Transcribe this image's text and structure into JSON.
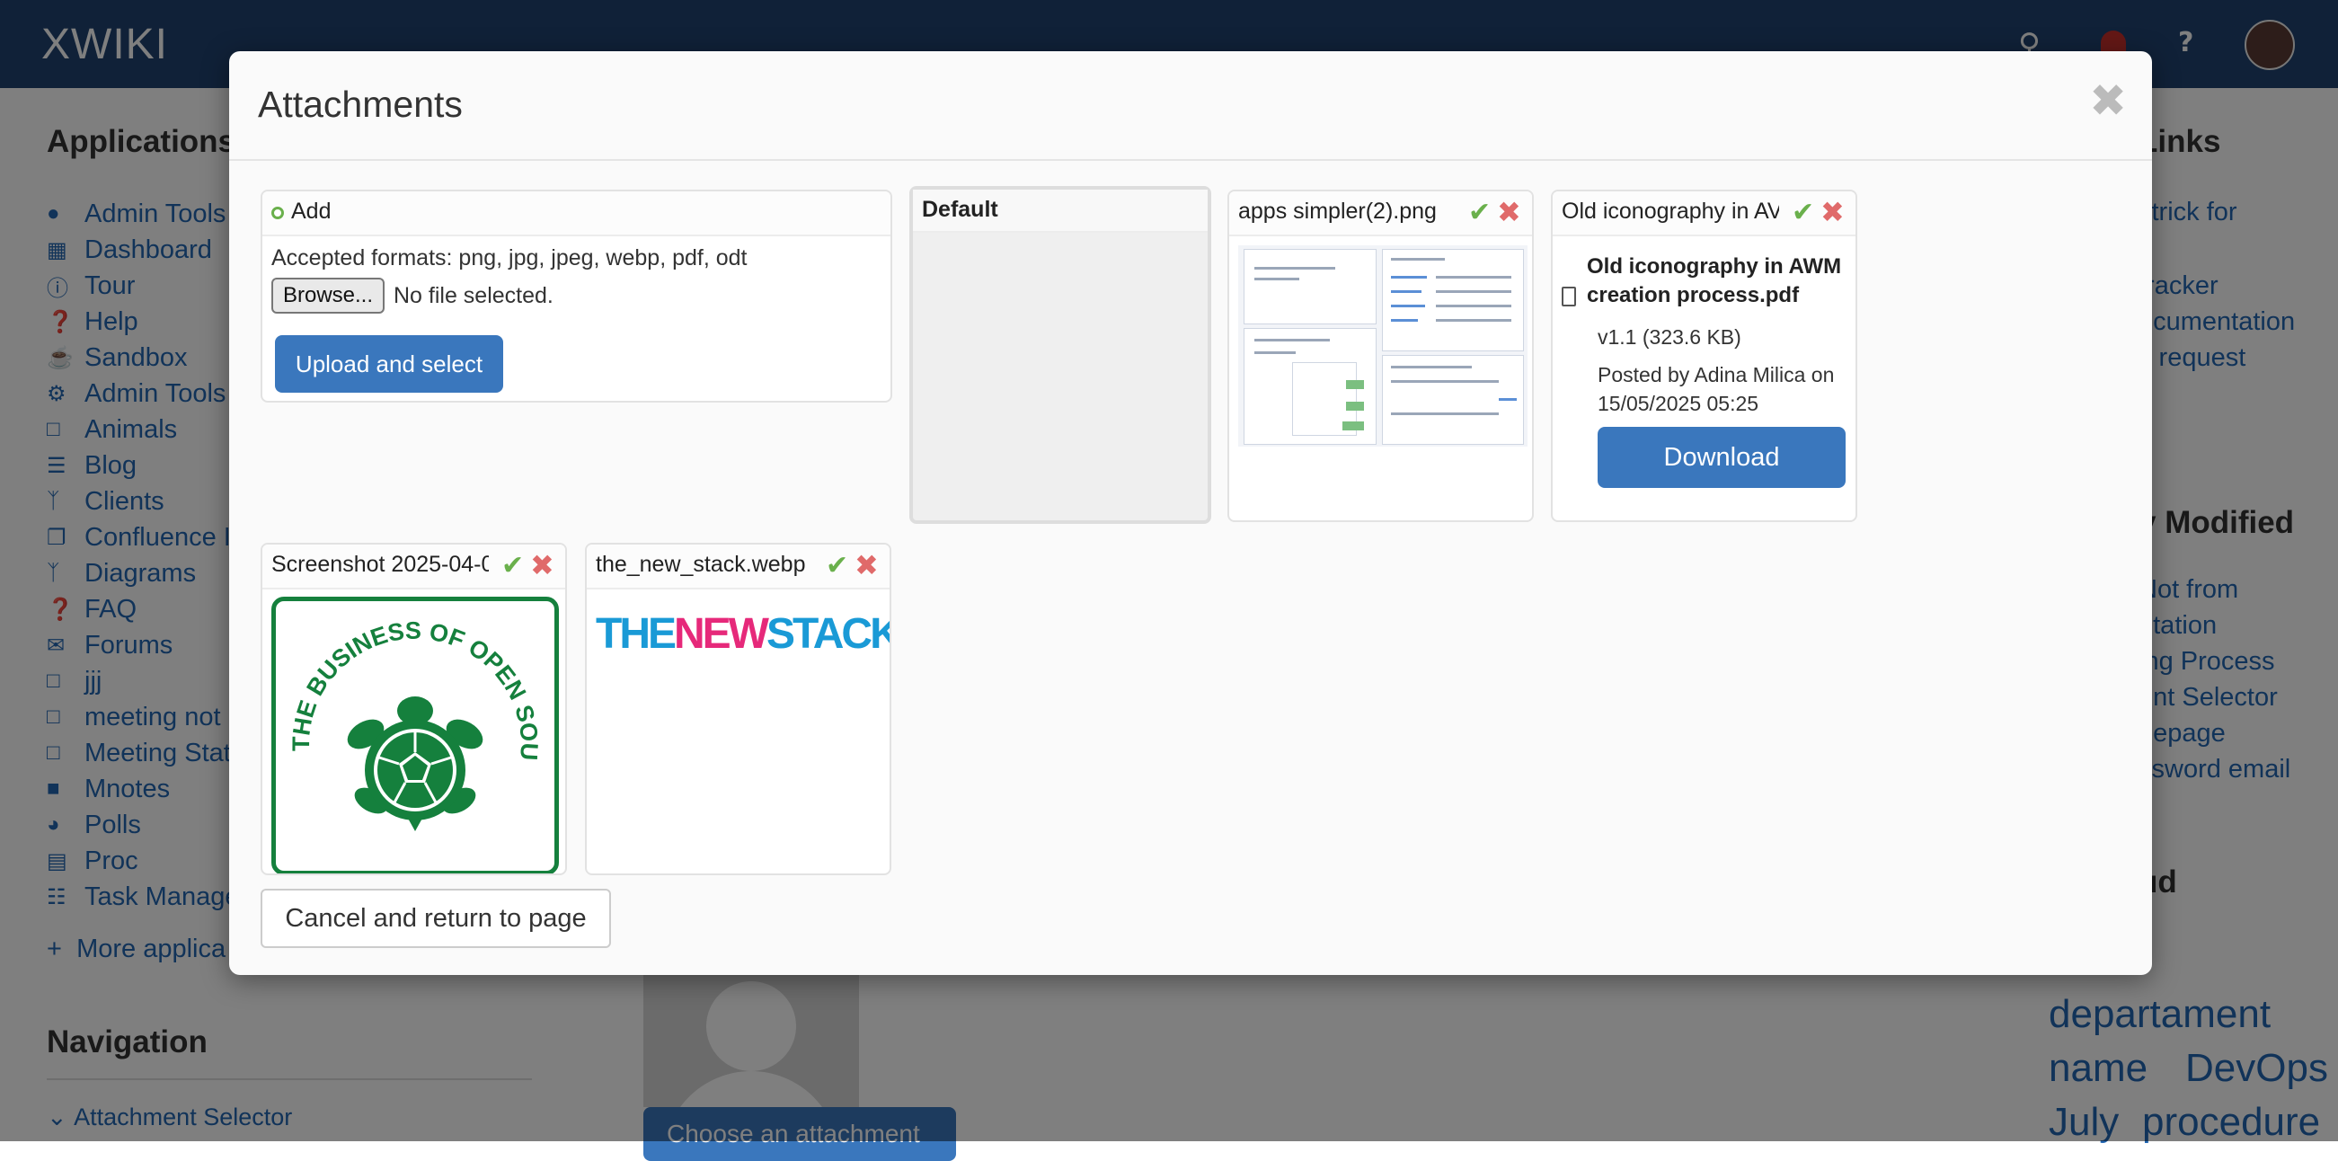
{
  "topbar": {
    "logo": "XWIKI",
    "search_icon": "search-icon",
    "help_label": "?"
  },
  "left": {
    "applications_title": "Applications",
    "apps": [
      {
        "label": "Admin Tools",
        "icon": "globe-icon"
      },
      {
        "label": "Dashboard",
        "icon": "dashboard-icon"
      },
      {
        "label": "Tour",
        "icon": "info-icon"
      },
      {
        "label": "Help",
        "icon": "question-icon"
      },
      {
        "label": "Sandbox",
        "icon": "cup-icon"
      },
      {
        "label": "Admin Tools",
        "icon": "gear-icon"
      },
      {
        "label": "Animals",
        "icon": "square-icon"
      },
      {
        "label": "Blog",
        "icon": "rss-icon"
      },
      {
        "label": "Clients",
        "icon": "branch-icon"
      },
      {
        "label": "Confluence I",
        "icon": "copy-icon"
      },
      {
        "label": "Diagrams",
        "icon": "branch-icon"
      },
      {
        "label": "FAQ",
        "icon": "question-icon"
      },
      {
        "label": "Forums",
        "icon": "comments-icon"
      },
      {
        "label": "jjj",
        "icon": "square-icon"
      },
      {
        "label": "meeting not",
        "icon": "square-icon"
      },
      {
        "label": "Meeting Stat",
        "icon": "square-icon"
      },
      {
        "label": "Mnotes",
        "icon": "briefcase-icon"
      },
      {
        "label": "Polls",
        "icon": "pie-icon"
      },
      {
        "label": "Proc",
        "icon": "book-icon"
      },
      {
        "label": "Task Manage",
        "icon": "list-icon"
      }
    ],
    "more_apps": "More applica",
    "navigation_title": "Navigation",
    "nav_item": "Attachment Selector"
  },
  "right": {
    "links_title": "Links",
    "links": [
      "l trick for",
      "tracker",
      "ocumentation",
      "y request"
    ],
    "modified_title": "y Modified",
    "modified": [
      "Not from",
      "ntation",
      "ing Process",
      "ent Selector",
      "nepage",
      "ssword email"
    ],
    "cloud_title": "ud",
    "cloud_line1": "departament",
    "cloud_line2a": "name",
    "cloud_line2b": "DevOps",
    "cloud_line3a": "July",
    "cloud_line3b": "procedure"
  },
  "background": {
    "choose_button": "Choose an attachment"
  },
  "modal": {
    "title": "Attachments",
    "add_title": "Add",
    "accepted_formats": "Accepted formats: png, jpg, jpeg, webp, pdf, odt",
    "browse_label": "Browse...",
    "no_file": "No file selected.",
    "upload_label": "Upload and select",
    "default_title": "Default",
    "cancel_label": "Cancel and return to page",
    "attachments": [
      {
        "name": "apps simpler(2).png"
      },
      {
        "name": "Old iconography in AV",
        "file_title": "Old iconography in AWM creation process.pdf",
        "version": "v1.1 (323.6 KB)",
        "posted": "Posted by Adina Milica on 15/05/2025 05:25",
        "download_label": "Download"
      },
      {
        "name": "Screenshot 2025-04-0",
        "seal_text": "THE BUSINESS OF OPEN SOURCE"
      },
      {
        "name": "the_new_stack.webp",
        "logo_the": "THE",
        "logo_new": "NEW",
        "logo_stack": "STACK"
      }
    ]
  },
  "colors": {
    "topbar": "#204370",
    "primary_button": "#3a77bd",
    "link": "#2367b3",
    "accept": "#6ab04c",
    "reject": "#e06a6a",
    "turtle_green": "#15803d",
    "tns_blue": "#1a9ad6",
    "tns_pink": "#e6297a"
  }
}
